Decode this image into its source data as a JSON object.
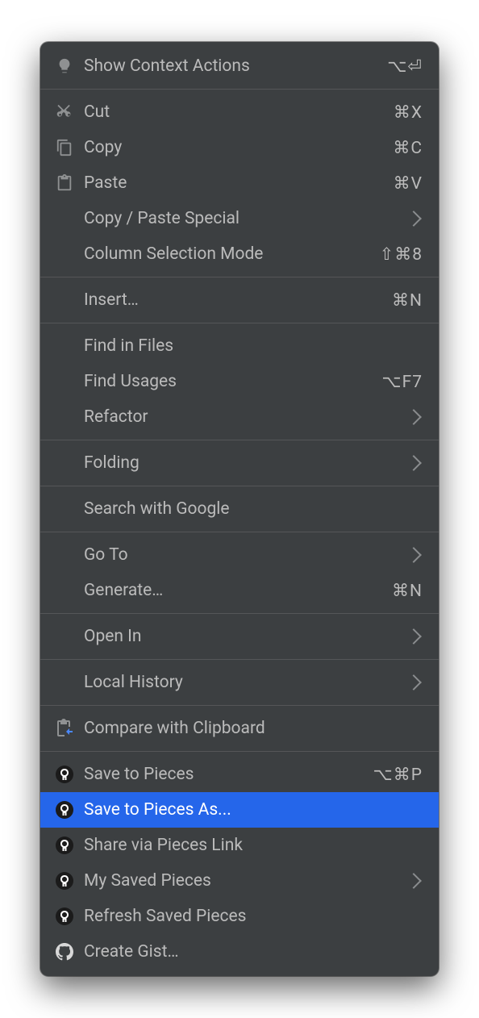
{
  "menu": {
    "items": [
      {
        "label": "Show Context Actions",
        "shortcut": "⌥⏎"
      },
      {
        "label": "Cut",
        "shortcut": "⌘X"
      },
      {
        "label": "Copy",
        "shortcut": "⌘C"
      },
      {
        "label": "Paste",
        "shortcut": "⌘V"
      },
      {
        "label": "Copy / Paste Special"
      },
      {
        "label": "Column Selection Mode",
        "shortcut": "⇧⌘8"
      },
      {
        "label": "Insert…",
        "shortcut": "⌘N"
      },
      {
        "label": "Find in Files"
      },
      {
        "label": "Find Usages",
        "shortcut": "⌥F7"
      },
      {
        "label": "Refactor"
      },
      {
        "label": "Folding"
      },
      {
        "label": "Search with Google"
      },
      {
        "label": "Go To"
      },
      {
        "label": "Generate…",
        "shortcut": "⌘N"
      },
      {
        "label": "Open In"
      },
      {
        "label": "Local History"
      },
      {
        "label": "Compare with Clipboard"
      },
      {
        "label": "Save to Pieces",
        "shortcut": "⌥⌘P"
      },
      {
        "label": "Save to Pieces As..."
      },
      {
        "label": "Share via Pieces Link"
      },
      {
        "label": "My Saved Pieces"
      },
      {
        "label": "Refresh Saved Pieces"
      },
      {
        "label": "Create Gist…"
      }
    ]
  }
}
